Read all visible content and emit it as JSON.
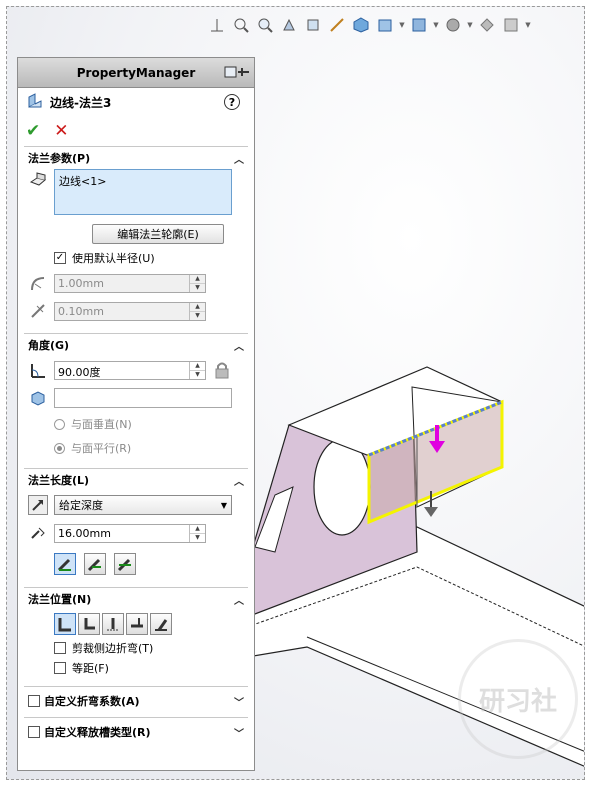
{
  "panel": {
    "title": "PropertyManager"
  },
  "feature": {
    "name": "边线-法兰3",
    "help": "?"
  },
  "actions": {
    "ok": "✔",
    "cancel": "✕"
  },
  "flange_params": {
    "header": "法兰参数(P)",
    "edge_item": "边线<1>",
    "edit_profile_button": "编辑法兰轮廓(E)",
    "use_default_radius": "使用默认半径(U)",
    "use_default_radius_checked": true,
    "radius_value": "1.00mm",
    "gap_value": "0.10mm"
  },
  "angle": {
    "header": "角度(G)",
    "angle_value": "90.00度",
    "face_value": "",
    "perpendicular_label": "与面垂直(N)",
    "parallel_label": "与面平行(R)"
  },
  "flange_length": {
    "header": "法兰长度(L)",
    "end_condition": "给定深度",
    "length_value": "16.00mm"
  },
  "flange_position": {
    "header": "法兰位置(N)",
    "trim_side_bends": "剪裁侧边折弯(T)",
    "offset": "等距(F)"
  },
  "custom_bend_allowance": {
    "label": "自定义折弯系数(A)"
  },
  "custom_relief_type": {
    "label": "自定义释放槽类型(R)"
  },
  "watermark": {
    "text": "研习社"
  },
  "colors": {
    "header_bg": "#c4c4c4",
    "listbox_bg": "#d9ebfb",
    "ok_green": "#2e9b2e",
    "cancel_red": "#cc1a1a",
    "sheet_face": "#d9c3d9",
    "highlight_yellow": "#f4f400",
    "arrow_magenta": "#e000e0"
  }
}
